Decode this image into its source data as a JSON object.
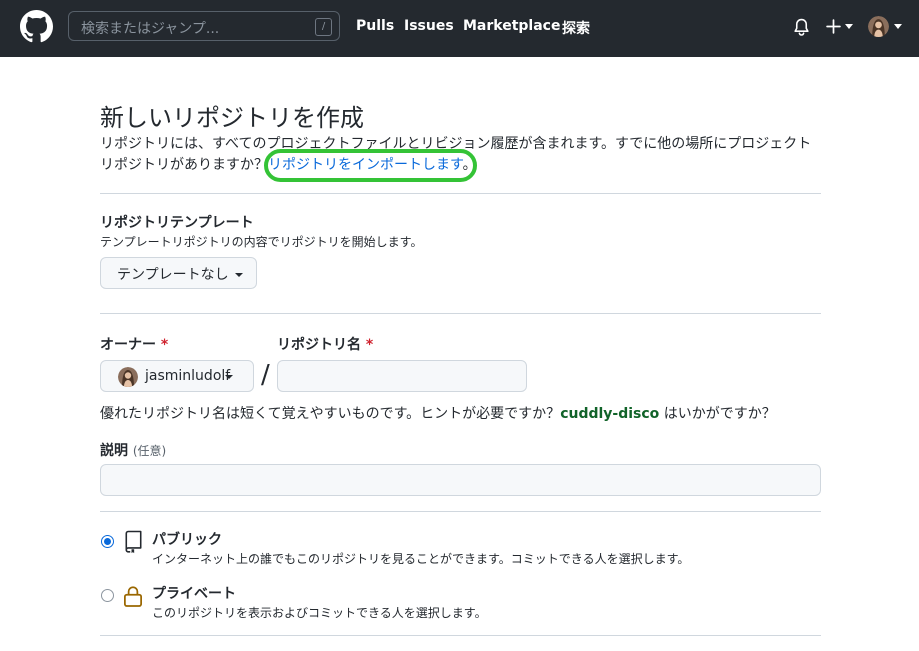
{
  "header": {
    "search_placeholder": "検索またはジャンプ...",
    "search_shortcut": "/",
    "nav": [
      "Pulls",
      "Issues",
      "Marketplace",
      "探索"
    ]
  },
  "page": {
    "title": "新しいリポジトリを作成",
    "intro": "リポジトリには、すべてのプロジェクトファイルとリビジョン履歴が含まれます。すでに他の場所にプロジェクトリポジトリがありますか？",
    "import_link": "リポジトリをインポートします",
    "import_suffix": "。"
  },
  "template": {
    "title": "リポジトリテンプレート",
    "note": "テンプレートリポジトリの内容でリポジトリを開始します。",
    "button": "テンプレートなし"
  },
  "owner": {
    "label": "オーナー",
    "required": "*",
    "value": "jasminludolf"
  },
  "repo": {
    "label": "リポジトリ名",
    "required": "*",
    "separator": "/",
    "value": ""
  },
  "suggestion": {
    "prefix": "優れたリポジトリ名は短くて覚えやすいものです。ヒントが必要ですか？",
    "name": "cuddly-disco",
    "suffix": "はいかがですか？"
  },
  "description": {
    "label": "説明",
    "optional": "(任意)",
    "value": ""
  },
  "visibility": [
    {
      "label": "パブリック",
      "note": "インターネット上の誰でもこのリポジトリを見ることができます。コミットできる人を選択します。",
      "selected": true
    },
    {
      "label": "プライベート",
      "note": "このリポジトリを表示およびコミットできる人を選択します。",
      "selected": false
    }
  ],
  "colors": {
    "header_bg": "#24292f",
    "link": "#0969da",
    "highlight": "#34c336",
    "suggestion": "#116329",
    "required": "#cf222e"
  },
  "icons": [
    "github-logo-icon",
    "bell-icon",
    "plus-icon",
    "repo-icon",
    "lock-icon"
  ]
}
